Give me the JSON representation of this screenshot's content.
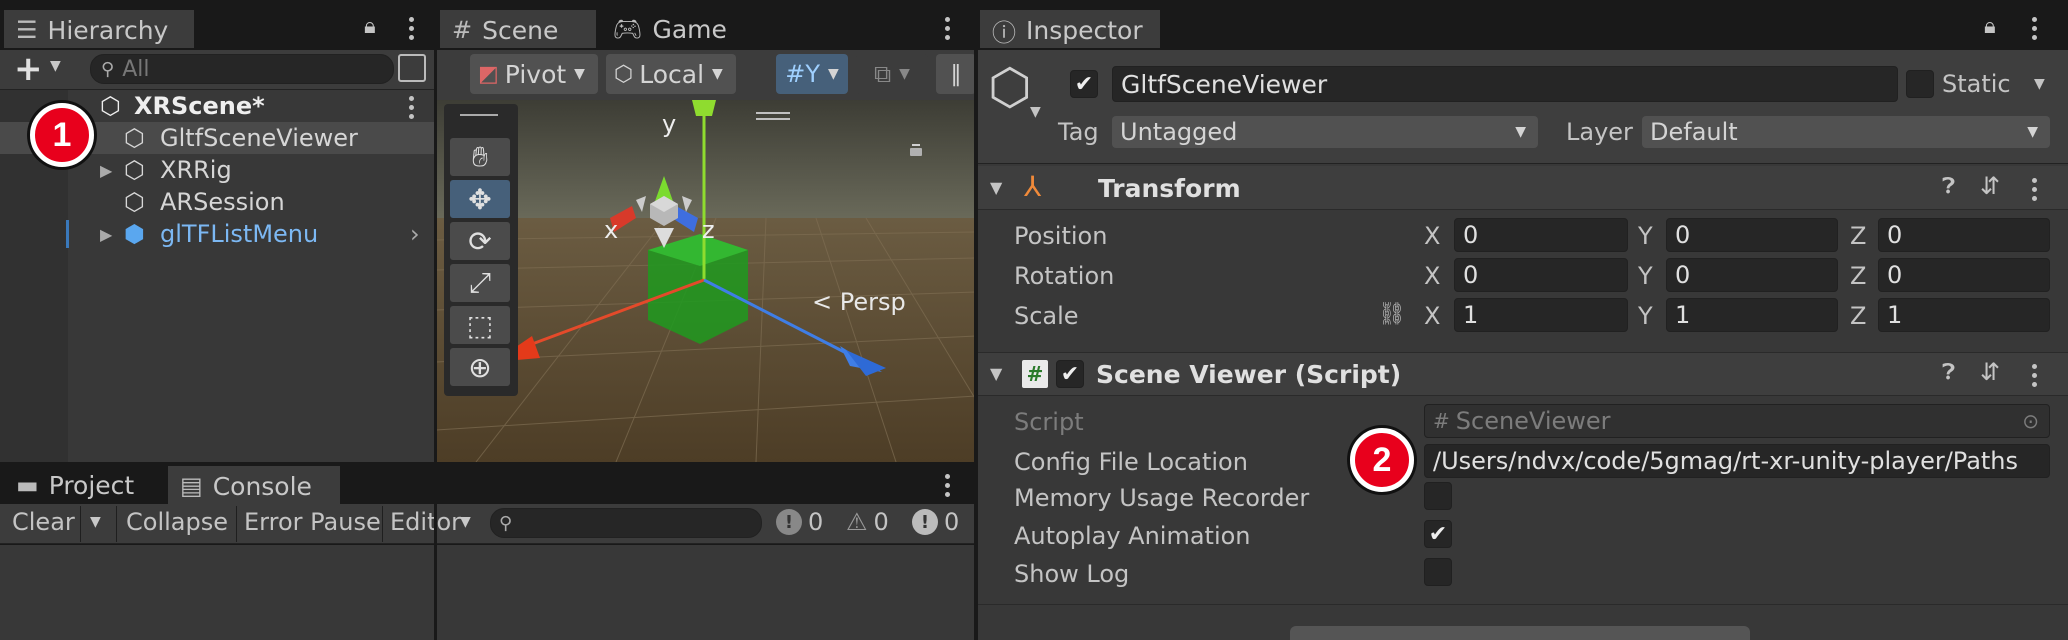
{
  "hierarchy": {
    "tab_label": "Hierarchy",
    "search_placeholder": "All",
    "add_label": "+",
    "scene_name": "XRScene*",
    "items": [
      {
        "label": "GltfSceneViewer"
      },
      {
        "label": "XRRig"
      },
      {
        "label": "ARSession"
      },
      {
        "label": "glTFListMenu"
      }
    ]
  },
  "scene": {
    "tab_scene": "Scene",
    "tab_game": "Game",
    "pivot_label": "Pivot",
    "local_label": "Local",
    "persp_label": "< Persp",
    "axis_x": "x",
    "axis_y": "y",
    "axis_z": "z"
  },
  "console": {
    "tab_project": "Project",
    "tab_console": "Console",
    "clear_label": "Clear",
    "collapse_label": "Collapse",
    "error_pause_label": "Error Pause",
    "editor_label": "Editor",
    "log_count": "0",
    "warning_count": "0",
    "error_count": "0"
  },
  "inspector": {
    "tab_label": "Inspector",
    "object_name": "GltfSceneViewer",
    "static_label": "Static",
    "tag_label": "Tag",
    "tag_value": "Untagged",
    "layer_label": "Layer",
    "layer_value": "Default",
    "transform": {
      "title": "Transform",
      "position_label": "Position",
      "rotation_label": "Rotation",
      "scale_label": "Scale",
      "x": "X",
      "y": "Y",
      "z": "Z",
      "position": [
        "0",
        "0",
        "0"
      ],
      "rotation": [
        "0",
        "0",
        "0"
      ],
      "scale": [
        "1",
        "1",
        "1"
      ]
    },
    "script_component": {
      "title": "Scene Viewer (Script)",
      "script_label": "Script",
      "script_value": "SceneViewer",
      "config_label": "Config File Location",
      "config_value": "/Users/ndvx/code/5gmag/rt-xr-unity-player/Paths",
      "memory_label": "Memory Usage Recorder",
      "autoplay_label": "Autoplay Animation",
      "showlog_label": "Show Log",
      "memory_checked": false,
      "autoplay_checked": true,
      "showlog_checked": false
    }
  },
  "annotations": {
    "badge1": "1",
    "badge2": "2"
  }
}
